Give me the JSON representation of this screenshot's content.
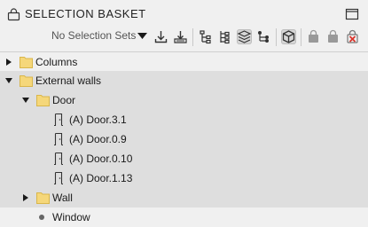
{
  "panel": {
    "title": "SELECTION BASKET"
  },
  "toolbar": {
    "selection_sets_label": "No Selection Sets",
    "icons": [
      "import-download-icon",
      "import-to-basket-icon",
      "tree-hierarchy-icon",
      "tree-flat-icon",
      "layers-icon",
      "tree-dots-icon",
      "3d-cube-icon",
      "basket-icon",
      "basket-remove-icon",
      "basket-clear-icon"
    ]
  },
  "tree": {
    "items": [
      {
        "label": "Columns",
        "type": "folder",
        "level": 0,
        "expanded": false
      },
      {
        "label": "External walls",
        "type": "folder",
        "level": 0,
        "expanded": true
      },
      {
        "label": "Door",
        "type": "folder",
        "level": 1,
        "expanded": true
      },
      {
        "label": "(A) Door.3.1",
        "type": "door",
        "level": 2
      },
      {
        "label": "(A) Door.0.9",
        "type": "door",
        "level": 2
      },
      {
        "label": "(A) Door.0.10",
        "type": "door",
        "level": 2
      },
      {
        "label": "(A) Door.1.13",
        "type": "door",
        "level": 2
      },
      {
        "label": "Wall",
        "type": "folder",
        "level": 1,
        "expanded": false
      },
      {
        "label": "Window",
        "type": "bullet",
        "level": 1
      }
    ]
  },
  "colors": {
    "folder": "#f5d77a",
    "folder_edge": "#d9b64a",
    "row_shade": "#dedede",
    "clear_red": "#d9342b"
  }
}
